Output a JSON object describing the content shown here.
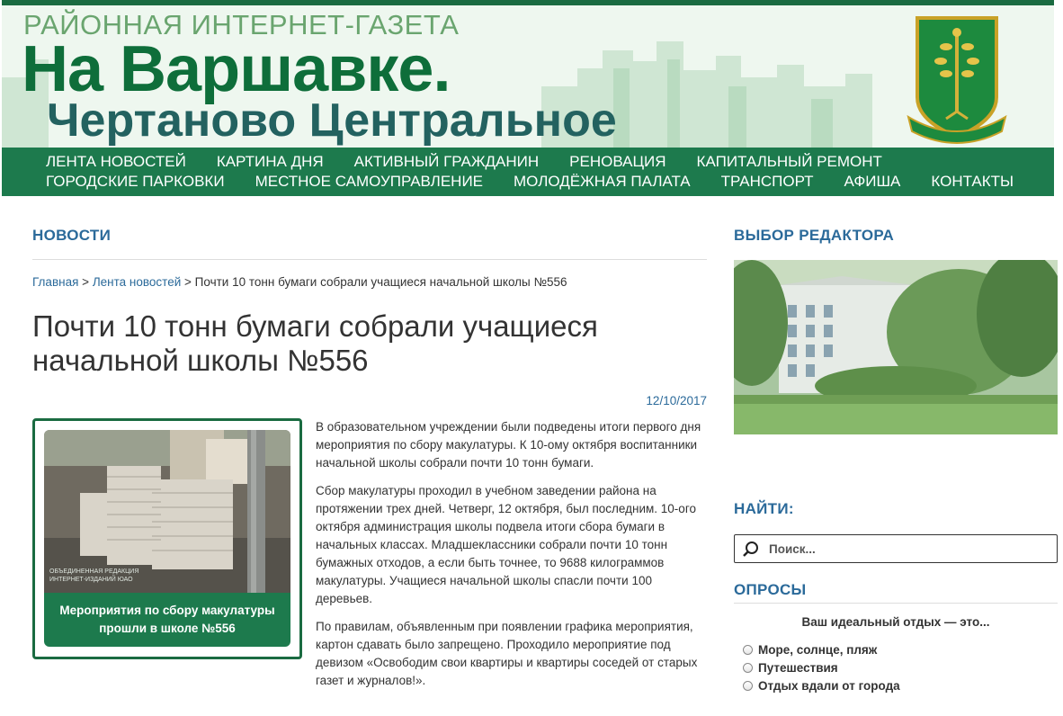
{
  "header": {
    "line1": "РАЙОННАЯ ИНТЕРНЕТ-ГАЗЕТА",
    "line2": "На Варшавке.",
    "line3": "Чертаново Центральное",
    "emblem_text": "ЧЕРТАНОВО ЦЕНТРАЛЬНОЕ",
    "colors": {
      "brand_green": "#1d7a4d",
      "dark_green": "#0e6e3a",
      "teal": "#236260"
    }
  },
  "nav": {
    "row1": [
      "ЛЕНТА НОВОСТЕЙ",
      "КАРТИНА ДНЯ",
      "АКТИВНЫЙ ГРАЖДАНИН",
      "РЕНОВАЦИЯ",
      "КАПИТАЛЬНЫЙ РЕМОНТ"
    ],
    "row2": [
      "ГОРОДСКИЕ ПАРКОВКИ",
      "МЕСТНОЕ САМОУПРАВЛЕНИЕ",
      "МОЛОДЁЖНАЯ ПАЛАТА",
      "ТРАНСПОРТ",
      "АФИША",
      "КОНТАКТЫ"
    ]
  },
  "main": {
    "section_title": "НОВОСТИ",
    "breadcrumb": {
      "home": "Главная",
      "sep": ">",
      "feed": "Лента новостей",
      "current": "Почти 10 тонн бумаги собрали учащиеся начальной школы №556"
    },
    "title": "Почти 10 тонн бумаги собрали учащиеся начальной школы №556",
    "date": "12/10/2017",
    "feature": {
      "caption": "Мероприятия по сбору макулатуры прошли в школе №556",
      "watermark_line1": "ОБЪЕДИНЕННАЯ РЕДАКЦИЯ",
      "watermark_line2": "ИНТЕРНЕТ-ИЗДАНИЙ ЮАО"
    },
    "paragraphs": [
      "В образовательном учреждении были подведены итоги первого дня мероприятия по сбору макулатуры. К 10-ому октября воспитанники начальной школы собрали почти 10 тонн бумаги.",
      "Сбор макулатуры проходил в учебном заведении района на протяжении трех дней. Четверг, 12 октября, был последним. 10-ого октября администрация школы подвела итоги сбора бумаги в начальных классах. Младшеклассники собрали почти 10 тонн бумажных отходов, а если быть точнее, то 9688 килограммов макулатуры. Учащиеся начальной школы спасли почти 100 деревьев.",
      "По правилам, объявленным при появлении графика мероприятия, картон сдавать было запрещено. Проходило мероприятие под девизом «Освободим свои квартиры и квартиры соседей от старых газет и  журналов!»."
    ]
  },
  "sidebar": {
    "editor_title": "ВЫБОР РЕДАКТОРА",
    "find_title": "НАЙТИ:",
    "search_placeholder": "Поиск...",
    "polls_title": "ОПРОСЫ",
    "poll_question": "Ваш идеальный отдых — это...",
    "poll_options": [
      "Море, солнце, пляж",
      "Путешествия",
      "Отдых вдали от города"
    ]
  }
}
